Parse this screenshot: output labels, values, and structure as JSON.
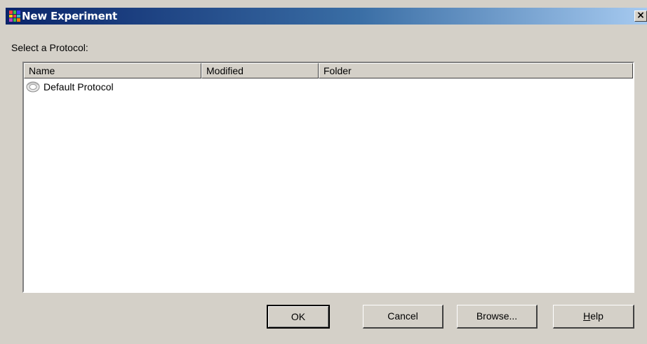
{
  "window": {
    "title": "New Experiment",
    "close_glyph": "×",
    "title_icon": "app-grid-icon",
    "title_icon_colors": [
      "#ff4040",
      "#40c040",
      "#4040ff",
      "#ffd000",
      "#ff4040",
      "#40c0c0",
      "#c040c0",
      "#40c040",
      "#ff8000"
    ]
  },
  "prompt": "Select a Protocol:",
  "list": {
    "columns": [
      {
        "label": "Name"
      },
      {
        "label": "Modified"
      },
      {
        "label": "Folder"
      }
    ],
    "rows": [
      {
        "name": "Default Protocol",
        "modified": "",
        "folder": "",
        "icon": "protocol-icon"
      }
    ]
  },
  "buttons": {
    "ok": "OK",
    "cancel": "Cancel",
    "browse": "Browse...",
    "help": "Help"
  }
}
